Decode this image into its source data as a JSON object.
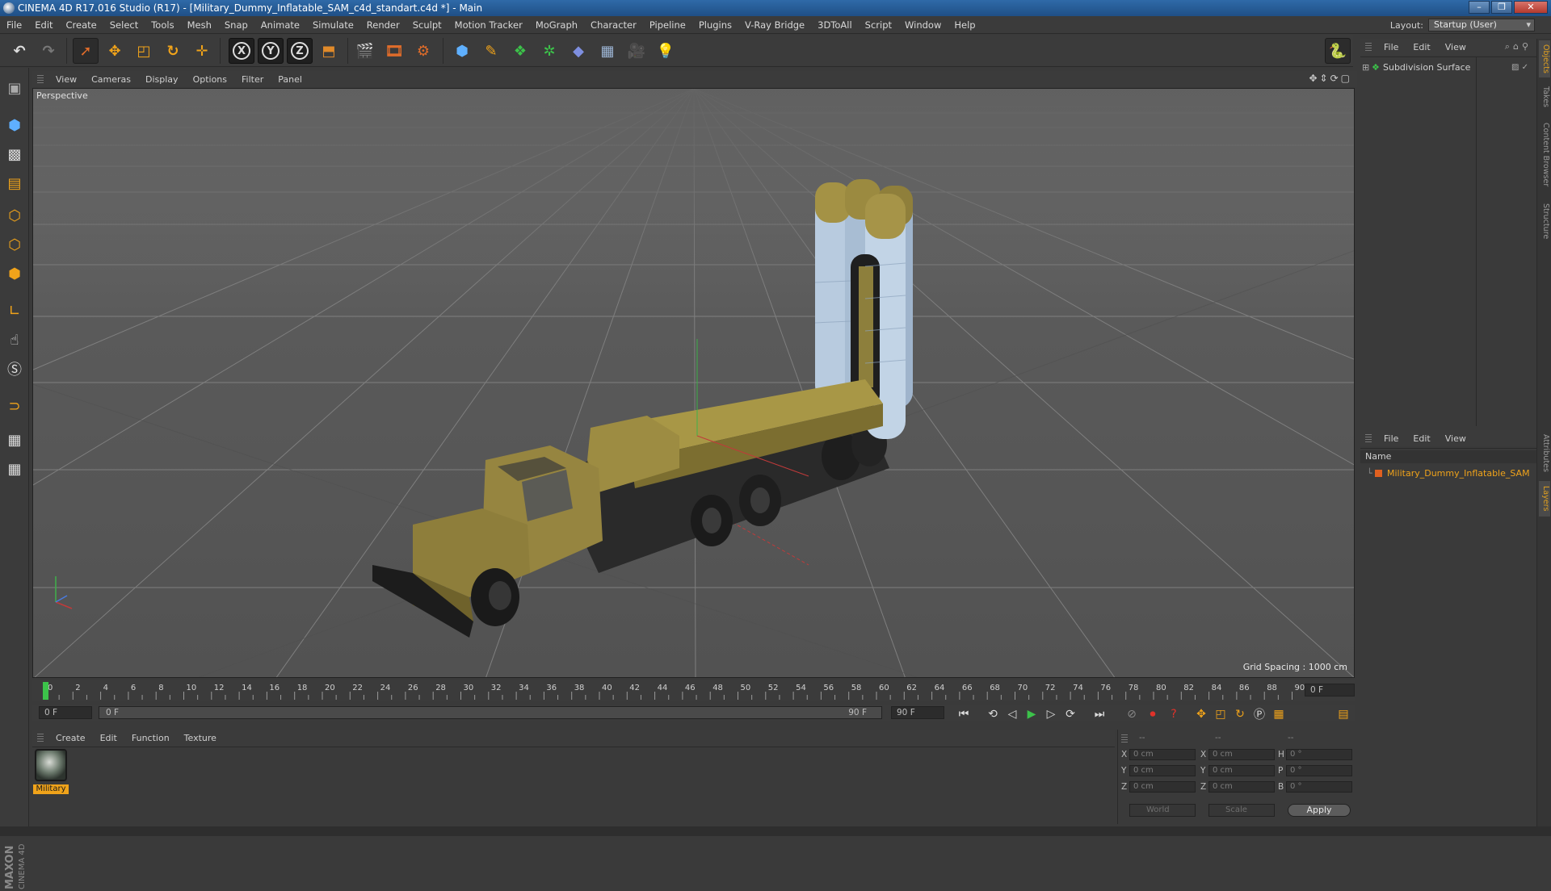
{
  "window": {
    "title": "CINEMA 4D R17.016 Studio (R17) - [Military_Dummy_Inflatable_SAM_c4d_standart.c4d *] - Main"
  },
  "menubar": [
    "File",
    "Edit",
    "Create",
    "Select",
    "Tools",
    "Mesh",
    "Snap",
    "Animate",
    "Simulate",
    "Render",
    "Sculpt",
    "Motion Tracker",
    "MoGraph",
    "Character",
    "Pipeline",
    "Plugins",
    "V-Ray Bridge",
    "3DToAll",
    "Script",
    "Window",
    "Help"
  ],
  "layout": {
    "label": "Layout:",
    "value": "Startup (User)"
  },
  "viewport": {
    "menu": [
      "View",
      "Cameras",
      "Display",
      "Options",
      "Filter",
      "Panel"
    ],
    "label": "Perspective",
    "grid_spacing": "Grid Spacing : 1000 cm"
  },
  "timeline": {
    "ticks": [
      "0",
      "2",
      "4",
      "6",
      "8",
      "10",
      "12",
      "14",
      "16",
      "18",
      "20",
      "22",
      "24",
      "26",
      "28",
      "30",
      "32",
      "34",
      "36",
      "38",
      "40",
      "42",
      "44",
      "46",
      "48",
      "50",
      "52",
      "54",
      "56",
      "58",
      "60",
      "62",
      "64",
      "66",
      "68",
      "70",
      "72",
      "74",
      "76",
      "78",
      "80",
      "82",
      "84",
      "86",
      "88",
      "90"
    ],
    "current_frame": "0 F",
    "start_field": "0 F",
    "range_start": "0 F",
    "range_end": "90 F",
    "end_field": "90 F"
  },
  "material_manager": {
    "menu": [
      "Create",
      "Edit",
      "Function",
      "Texture"
    ],
    "materials": [
      {
        "name": "Military"
      }
    ]
  },
  "coordinates": {
    "headers": [
      "--",
      "--",
      "--"
    ],
    "rows": [
      {
        "a": "X",
        "a_val": "0 cm",
        "b": "X",
        "b_val": "0 cm",
        "c": "H",
        "c_val": "0 °"
      },
      {
        "a": "Y",
        "a_val": "0 cm",
        "b": "Y",
        "b_val": "0 cm",
        "c": "P",
        "c_val": "0 °"
      },
      {
        "a": "Z",
        "a_val": "0 cm",
        "b": "Z",
        "b_val": "0 cm",
        "c": "B",
        "c_val": "0 °"
      }
    ],
    "mode_world": "World",
    "mode_scale": "Scale",
    "apply": "Apply"
  },
  "object_manager": {
    "menu": [
      "File",
      "Edit",
      "View"
    ],
    "objects": [
      {
        "name": "Subdivision Surface"
      }
    ]
  },
  "layer_manager": {
    "menu": [
      "File",
      "Edit",
      "View"
    ],
    "header": "Name",
    "layers": [
      {
        "name": "Military_Dummy_Inflatable_SAM"
      }
    ]
  },
  "side_tabs": [
    "Objects",
    "Takes",
    "Content Browser",
    "Structure"
  ],
  "side_tabs_lower": [
    "Attributes",
    "Layers"
  ],
  "brand": {
    "maxon": "MAXON",
    "product": "CINEMA 4D"
  },
  "colors": {
    "accent_orange": "#f0a31a",
    "title_blue": "#2f6aa8",
    "play_green": "#3cc24a"
  }
}
